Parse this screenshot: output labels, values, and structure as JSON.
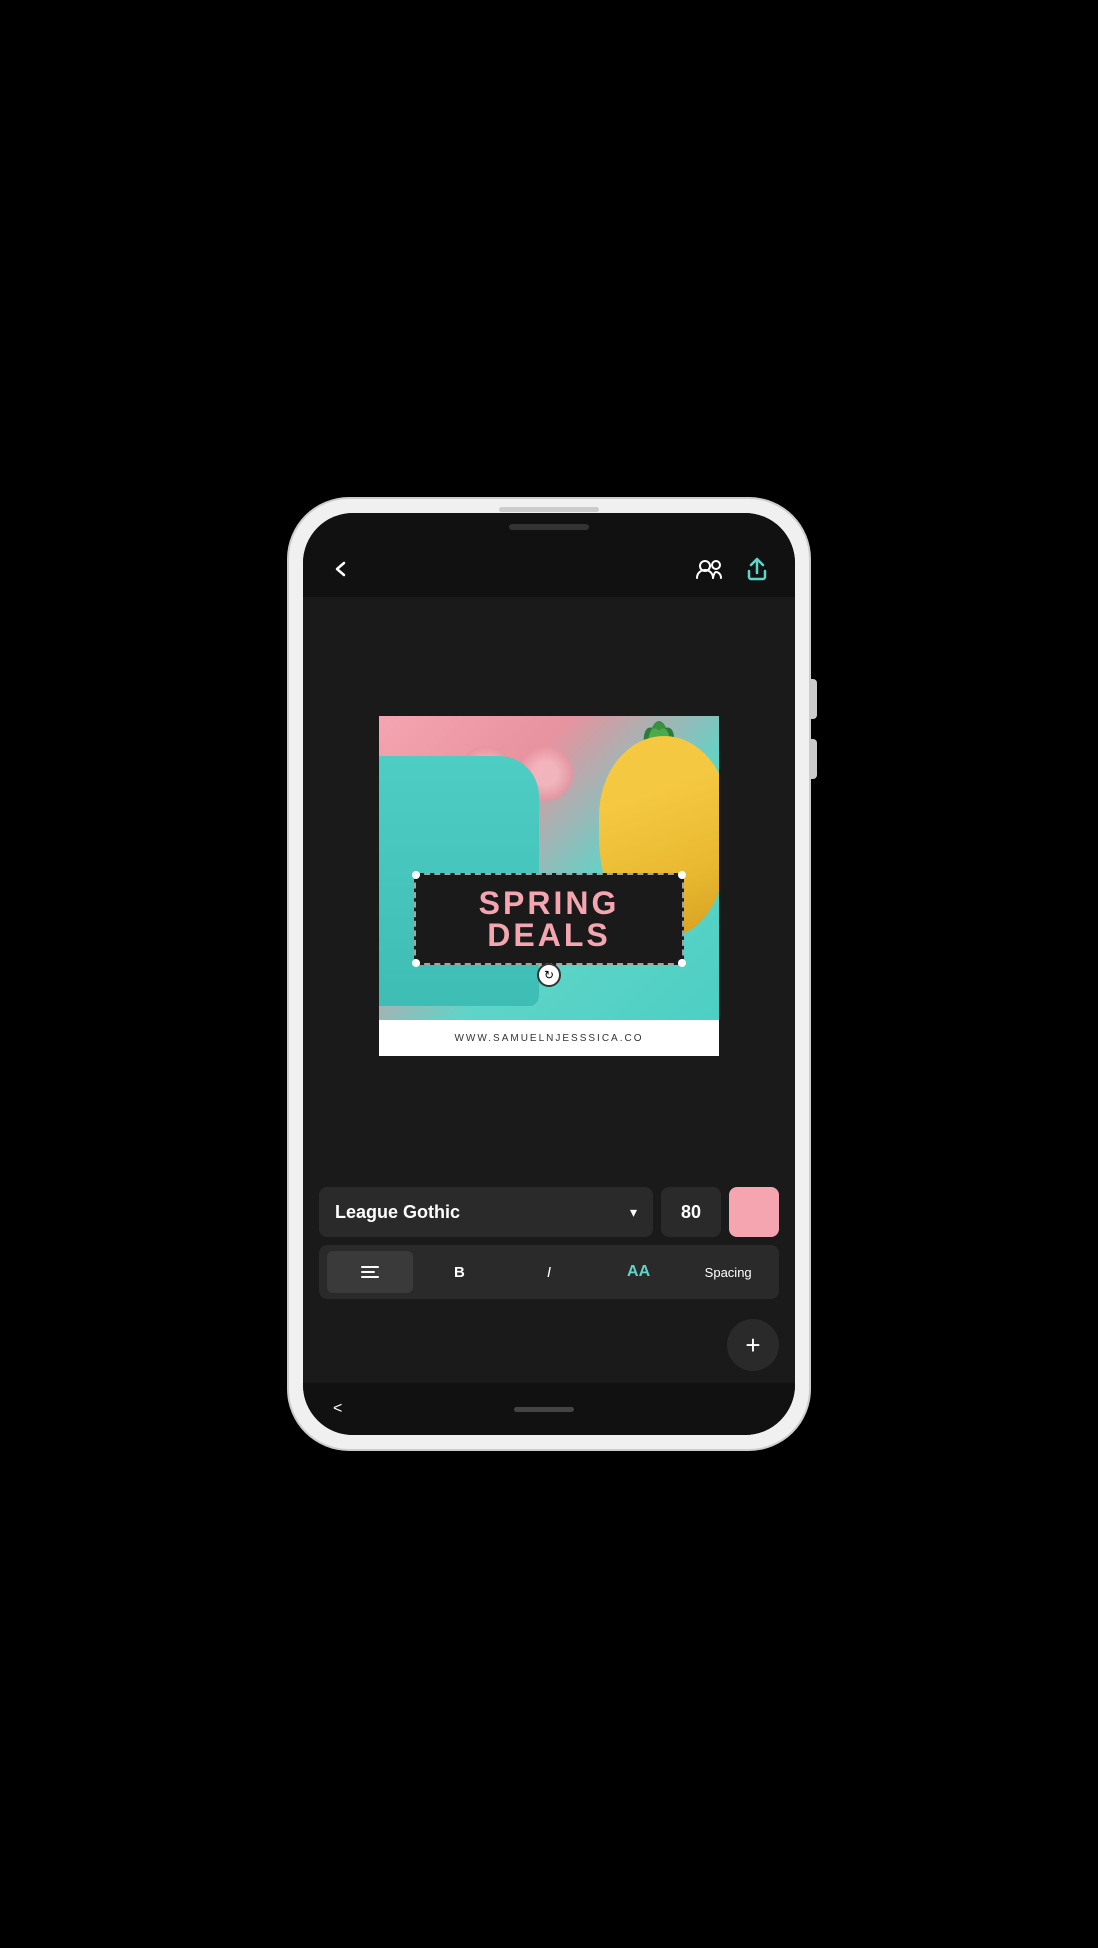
{
  "phone": {
    "status_bar": {}
  },
  "header": {
    "back_label": "←",
    "share_icon": "share",
    "collab_icon": "users"
  },
  "canvas": {
    "text_overlay": "SPRING DEALS",
    "website_text": "WWW.SAMUELNJESSSICA.CO",
    "rotate_icon": "↻"
  },
  "toolbar": {
    "font_name": "League Gothic",
    "font_size": "80",
    "color_hex": "#f4a5b0",
    "align_label": "align",
    "bold_label": "B",
    "italic_label": "I",
    "aa_label": "AA",
    "spacing_label": "Spacing"
  },
  "fab": {
    "label": "+"
  },
  "bottom_nav": {
    "back_label": "<"
  }
}
